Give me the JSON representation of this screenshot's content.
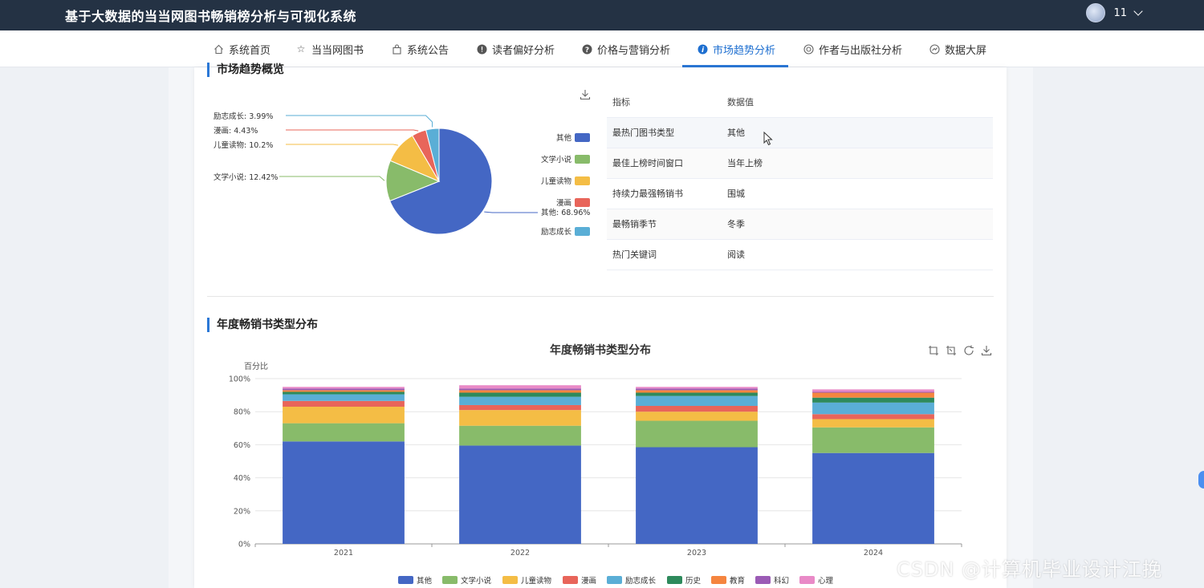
{
  "app": {
    "title": "基于大数据的当当网图书畅销榜分析与可视化系统"
  },
  "user": {
    "name": "11"
  },
  "nav": {
    "items": [
      {
        "label": "系统首页",
        "icon": "home-icon",
        "active": false
      },
      {
        "label": "当当网图书",
        "icon": "star-icon",
        "active": false
      },
      {
        "label": "系统公告",
        "icon": "bag-icon",
        "active": false
      },
      {
        "label": "读者偏好分析",
        "icon": "alert-icon",
        "active": false
      },
      {
        "label": "价格与营销分析",
        "icon": "question-icon",
        "active": false
      },
      {
        "label": "市场趋势分析",
        "icon": "info-icon",
        "active": true
      },
      {
        "label": "作者与出版社分析",
        "icon": "settings-icon",
        "active": false
      },
      {
        "label": "数据大屏",
        "icon": "dashboard-icon",
        "active": false
      }
    ]
  },
  "sections": {
    "overview_title": "市场趋势概览",
    "yearly_title": "年度畅销书类型分布"
  },
  "stats_table": {
    "headers": [
      "指标",
      "数据值"
    ],
    "rows": [
      {
        "metric": "最热门图书类型",
        "value": "其他"
      },
      {
        "metric": "最佳上榜时间窗口",
        "value": "当年上榜"
      },
      {
        "metric": "持续力最强畅销书",
        "value": "围城"
      },
      {
        "metric": "最畅销季节",
        "value": "冬季"
      },
      {
        "metric": "热门关键词",
        "value": "阅读"
      }
    ]
  },
  "watermark": "CSDN @计算机毕业设计江挽",
  "colors": {
    "其他": "#4467c4",
    "文学小说": "#88bb6a",
    "儿童读物": "#f4bd45",
    "漫画": "#e8655a",
    "励志成长": "#5aaed6",
    "历史": "#2e8a5c",
    "教育": "#f5853f",
    "科幻": "#9b5bb5",
    "心理": "#e98ac7",
    "accent": "#2b78d6",
    "topbar": "#243244"
  },
  "chart_data": [
    {
      "type": "pie",
      "slices": [
        {
          "name": "其他",
          "value": 68.96,
          "label": "其他: 68.96%"
        },
        {
          "name": "文学小说",
          "value": 12.42,
          "label": "文学小说: 12.42%"
        },
        {
          "name": "儿童读物",
          "value": 10.2,
          "label": "儿童读物: 10.2%"
        },
        {
          "name": "漫画",
          "value": 4.43,
          "label": "漫画: 4.43%"
        },
        {
          "name": "励志成长",
          "value": 3.99,
          "label": "励志成长: 3.99%"
        }
      ],
      "legend": [
        "其他",
        "文学小说",
        "儿童读物",
        "漫画",
        "励志成长"
      ],
      "legend_position": "right"
    },
    {
      "type": "bar",
      "stacked": true,
      "title": "年度畅销书类型分布",
      "ylabel": "百分比",
      "ylim": [
        0,
        100
      ],
      "yticks": [
        "0%",
        "20%",
        "40%",
        "60%",
        "80%",
        "100%"
      ],
      "categories": [
        "2021",
        "2022",
        "2023",
        "2024"
      ],
      "series": [
        {
          "name": "其他",
          "values": [
            62,
            59.5,
            58.5,
            55
          ]
        },
        {
          "name": "文学小说",
          "values": [
            11,
            12,
            16,
            15.5
          ]
        },
        {
          "name": "儿童读物",
          "values": [
            10,
            9.5,
            5.5,
            5
          ]
        },
        {
          "name": "漫画",
          "values": [
            3.5,
            3,
            3.5,
            3
          ]
        },
        {
          "name": "励志成长",
          "values": [
            4,
            5,
            6,
            7
          ]
        },
        {
          "name": "历史",
          "values": [
            1.5,
            2.5,
            2,
            3
          ]
        },
        {
          "name": "教育",
          "values": [
            1,
            1.5,
            1.5,
            3
          ]
        },
        {
          "name": "科幻",
          "values": [
            1,
            1,
            1,
            0.5
          ]
        },
        {
          "name": "心理",
          "values": [
            1,
            2,
            1,
            1.5
          ]
        }
      ],
      "legend_position": "bottom",
      "grid": true
    }
  ]
}
